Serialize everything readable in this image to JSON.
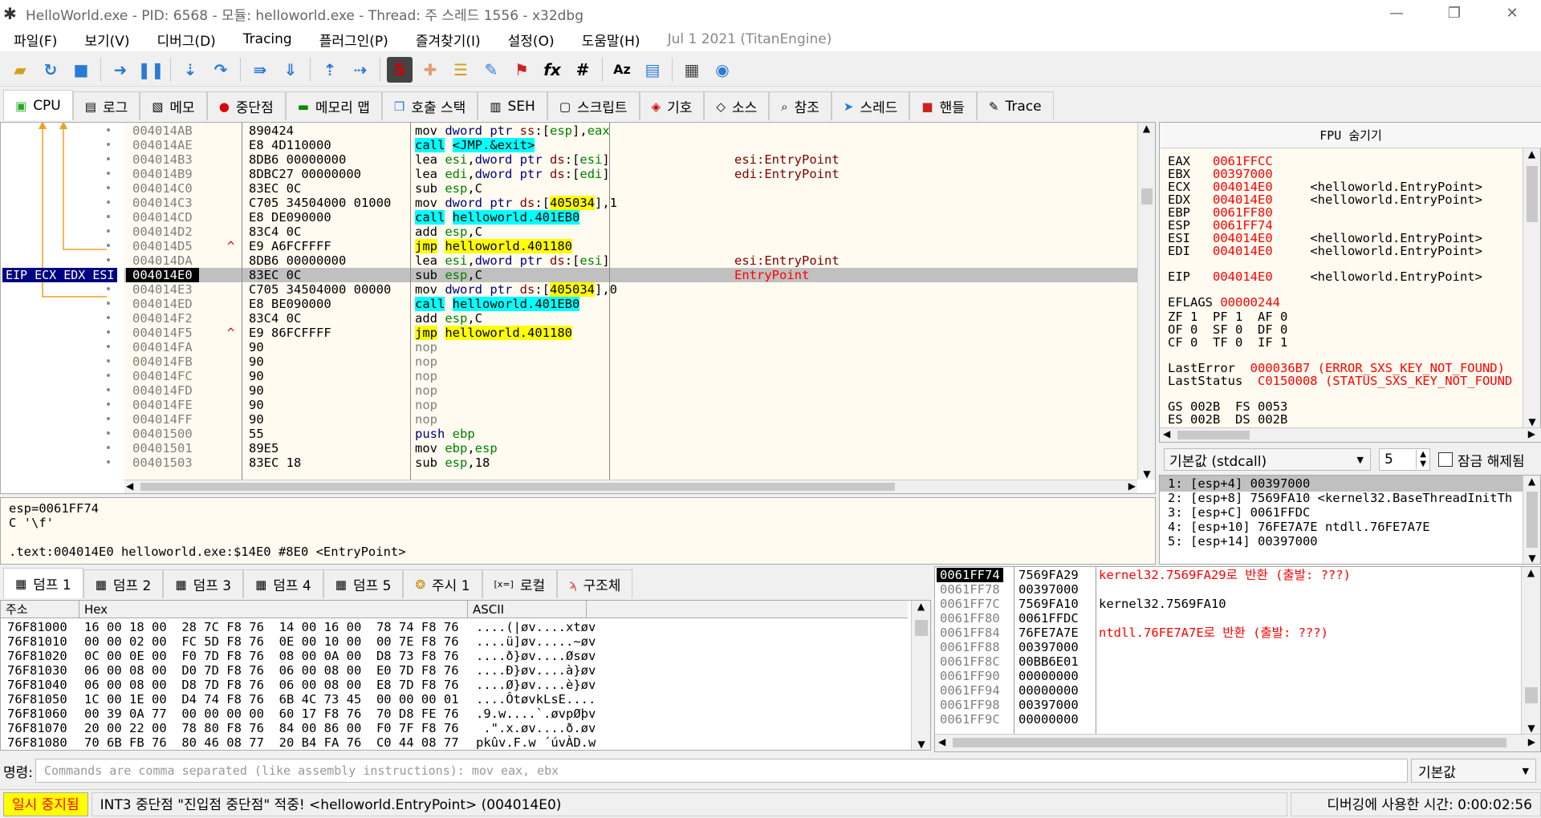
{
  "window": {
    "title": "HelloWorld.exe - PID: 6568 - 모듈: helloworld.exe - Thread: 주 스레드 1556 - x32dbg"
  },
  "menu": {
    "items": [
      "파일(F)",
      "보기(V)",
      "디버그(D)",
      "Tracing",
      "플러그인(P)",
      "즐겨찾기(I)",
      "설정(O)",
      "도움말(H)"
    ],
    "build": "Jul 1 2021 (TitanEngine)"
  },
  "tabs": [
    "CPU",
    "로그",
    "메모",
    "중단점",
    "메모리 맵",
    "호출 스택",
    "SEH",
    "스크립트",
    "기호",
    "소스",
    "참조",
    "스레드",
    "핸들",
    "Trace"
  ],
  "disasm": {
    "eip_label": "EIP ECX EDX ESI",
    "rows": [
      {
        "addr": "004014AB",
        "bytes": "890424",
        "ins": "mov dword ptr ss:[esp],eax",
        "cmt": ""
      },
      {
        "addr": "004014AE",
        "bytes": "E8 4D110000",
        "ins": "call <JMP.&exit>",
        "cmt": ""
      },
      {
        "addr": "004014B3",
        "bytes": "8DB6 00000000",
        "ins": "lea esi,dword ptr ds:[esi]",
        "cmt": "esi:EntryPoint"
      },
      {
        "addr": "004014B9",
        "bytes": "8DBC27 00000000",
        "ins": "lea edi,dword ptr ds:[edi]",
        "cmt": "edi:EntryPoint"
      },
      {
        "addr": "004014C0",
        "bytes": "83EC 0C",
        "ins": "sub esp,C",
        "cmt": ""
      },
      {
        "addr": "004014C3",
        "bytes": "C705 34504000 01000",
        "ins": "mov dword ptr ds:[405034],1",
        "cmt": ""
      },
      {
        "addr": "004014CD",
        "bytes": "E8 DE090000",
        "ins": "call helloworld.401EB0",
        "cmt": ""
      },
      {
        "addr": "004014D2",
        "bytes": "83C4 0C",
        "ins": "add esp,C",
        "cmt": ""
      },
      {
        "addr": "004014D5",
        "bytes": "E9 A6FCFFFF",
        "ins": "jmp helloworld.401180",
        "cmt": ""
      },
      {
        "addr": "004014DA",
        "bytes": "8DB6 00000000",
        "ins": "lea esi,dword ptr ds:[esi]",
        "cmt": "esi:EntryPoint"
      },
      {
        "addr": "004014E0",
        "bytes": "83EC 0C",
        "ins": "sub esp,C",
        "cmt": "EntryPoint"
      },
      {
        "addr": "004014E3",
        "bytes": "C705 34504000 00000",
        "ins": "mov dword ptr ds:[405034],0",
        "cmt": ""
      },
      {
        "addr": "004014ED",
        "bytes": "E8 BE090000",
        "ins": "call helloworld.401EB0",
        "cmt": ""
      },
      {
        "addr": "004014F2",
        "bytes": "83C4 0C",
        "ins": "add esp,C",
        "cmt": ""
      },
      {
        "addr": "004014F5",
        "bytes": "E9 86FCFFFF",
        "ins": "jmp helloworld.401180",
        "cmt": ""
      },
      {
        "addr": "004014FA",
        "bytes": "90",
        "ins": "nop",
        "cmt": ""
      },
      {
        "addr": "004014FB",
        "bytes": "90",
        "ins": "nop",
        "cmt": ""
      },
      {
        "addr": "004014FC",
        "bytes": "90",
        "ins": "nop",
        "cmt": ""
      },
      {
        "addr": "004014FD",
        "bytes": "90",
        "ins": "nop",
        "cmt": ""
      },
      {
        "addr": "004014FE",
        "bytes": "90",
        "ins": "nop",
        "cmt": ""
      },
      {
        "addr": "004014FF",
        "bytes": "90",
        "ins": "nop",
        "cmt": ""
      },
      {
        "addr": "00401500",
        "bytes": "55",
        "ins": "push ebp",
        "cmt": ""
      },
      {
        "addr": "00401501",
        "bytes": "89E5",
        "ins": "mov ebp,esp",
        "cmt": ""
      },
      {
        "addr": "00401503",
        "bytes": "83EC 18",
        "ins": "sub esp,18",
        "cmt": ""
      }
    ]
  },
  "registers": {
    "header": "FPU 숨기기",
    "lines": [
      {
        "name": "EAX",
        "val": "0061FFCC",
        "desc": ""
      },
      {
        "name": "EBX",
        "val": "00397000",
        "desc": ""
      },
      {
        "name": "ECX",
        "val": "004014E0",
        "desc": "<helloworld.EntryPoint>"
      },
      {
        "name": "EDX",
        "val": "004014E0",
        "desc": "<helloworld.EntryPoint>"
      },
      {
        "name": "EBP",
        "val": "0061FF80",
        "desc": ""
      },
      {
        "name": "ESP",
        "val": "0061FF74",
        "desc": ""
      },
      {
        "name": "ESI",
        "val": "004014E0",
        "desc": "<helloworld.EntryPoint>"
      },
      {
        "name": "EDI",
        "val": "004014E0",
        "desc": "<helloworld.EntryPoint>"
      },
      {
        "name": "",
        "val": "",
        "desc": ""
      },
      {
        "name": "EIP",
        "val": "004014E0",
        "desc": "<helloworld.EntryPoint>"
      },
      {
        "name": "",
        "val": "",
        "desc": ""
      },
      {
        "name": "EFLAGS",
        "val": "00000244",
        "desc": ""
      }
    ],
    "flags": [
      "ZF 1  PF 1  AF 0",
      "OF 0  SF 0  DF 0",
      "CF 0  TF 0  IF 1"
    ],
    "lasterror_label": "LastError",
    "lasterror": "000036B7 (ERROR_SXS_KEY_NOT_FOUND)",
    "laststatus_label": "LastStatus",
    "laststatus": "C0150008 (STATUS_SXS_KEY_NOT_FOUND",
    "seg1": "GS 002B  FS 0053",
    "seg2": "ES 002B  DS 002B"
  },
  "callconv": {
    "select": "기본값 (stdcall)",
    "count": "5",
    "unlock": "잠금 해제됨"
  },
  "args": [
    "1: [esp+4] 00397000",
    "2: [esp+8] 7569FA10 <kernel32.BaseThreadInitTh",
    "3: [esp+C] 0061FFDC",
    "4: [esp+10] 76FE7A7E ntdll.76FE7A7E",
    "5: [esp+14] 00397000"
  ],
  "info": {
    "line1": "esp=0061FF74",
    "line2": "C '\\f'",
    "line3": ".text:004014E0 helloworld.exe:$14E0 #8E0 <EntryPoint>"
  },
  "dumptabs": [
    "덤프 1",
    "덤프 2",
    "덤프 3",
    "덤프 4",
    "덤프 5",
    "주시 1",
    "로컬",
    "구조체"
  ],
  "dump": {
    "hdr_addr": "주소",
    "hdr_hex": "Hex",
    "hdr_ascii": "ASCII",
    "rows": [
      {
        "addr": "76F81000",
        "hex": "16 00 18 00  28 7C F8 76  14 00 16 00  78 74 F8 76",
        "ascii": "....(|øv....xtøv"
      },
      {
        "addr": "76F81010",
        "hex": "00 00 02 00  FC 5D F8 76  0E 00 10 00  00 7E F8 76",
        "ascii": "....ü]øv.....~øv"
      },
      {
        "addr": "76F81020",
        "hex": "0C 00 0E 00  F0 7D F8 76  08 00 0A 00  D8 73 F8 76",
        "ascii": "....ð}øv....Øsøv"
      },
      {
        "addr": "76F81030",
        "hex": "06 00 08 00  D0 7D F8 76  06 00 08 00  E0 7D F8 76",
        "ascii": "....Ð}øv....à}øv"
      },
      {
        "addr": "76F81040",
        "hex": "06 00 08 00  D8 7D F8 76  06 00 08 00  E8 7D F8 76",
        "ascii": "....Ø}øv....è}øv"
      },
      {
        "addr": "76F81050",
        "hex": "1C 00 1E 00  D4 74 F8 76  6B 4C 73 45  00 00 00 01",
        "ascii": "....ÔtøvkLsE...."
      },
      {
        "addr": "76F81060",
        "hex": "00 39 0A 77  00 00 00 00  60 17 F8 76  70 D8 FE 76",
        "ascii": ".9.w....`.øvpØþv"
      },
      {
        "addr": "76F81070",
        "hex": "20 00 22 00  78 80 F8 76  84 00 86 00  F0 7F F8 76",
        "ascii": " .\".x.øv....ð.øv"
      },
      {
        "addr": "76F81080",
        "hex": "70 6B FB 76  80 46 08 77  20 B4 FA 76  C0 44 08 77",
        "ascii": "pkûv.F.w ´úvÀD.w"
      }
    ]
  },
  "stack": [
    {
      "addr": "0061FF74",
      "val": "7569FA29",
      "cmt": "kernel32.7569FA29로 반환 (출발: ???)",
      "red": true,
      "current": true
    },
    {
      "addr": "0061FF78",
      "val": "00397000",
      "cmt": "",
      "red": false,
      "current": false
    },
    {
      "addr": "0061FF7C",
      "val": "7569FA10",
      "cmt": "kernel32.7569FA10",
      "red": false,
      "current": false
    },
    {
      "addr": "0061FF80",
      "val": "0061FFDC",
      "cmt": "",
      "red": false,
      "current": false
    },
    {
      "addr": "0061FF84",
      "val": "76FE7A7E",
      "cmt": "ntdll.76FE7A7E로 반환 (출발: ???)",
      "red": true,
      "current": false
    },
    {
      "addr": "0061FF88",
      "val": "00397000",
      "cmt": "",
      "red": false,
      "current": false
    },
    {
      "addr": "0061FF8C",
      "val": "00BB6E01",
      "cmt": "",
      "red": false,
      "current": false
    },
    {
      "addr": "0061FF90",
      "val": "00000000",
      "cmt": "",
      "red": false,
      "current": false
    },
    {
      "addr": "0061FF94",
      "val": "00000000",
      "cmt": "",
      "red": false,
      "current": false
    },
    {
      "addr": "0061FF98",
      "val": "00397000",
      "cmt": "",
      "red": false,
      "current": false
    },
    {
      "addr": "0061FF9C",
      "val": "00000000",
      "cmt": "",
      "red": false,
      "current": false
    }
  ],
  "cmd": {
    "label": "명령:",
    "placeholder": "Commands are comma separated (like assembly instructions): mov eax, ebx",
    "mode": "기본값"
  },
  "status": {
    "state": "일시 중지됨",
    "message": "INT3 중단점 \"진입점 중단점\" 적중! <helloworld.EntryPoint> (004014E0)",
    "time": "디버깅에 사용한 시간: 0:00:02:56"
  }
}
